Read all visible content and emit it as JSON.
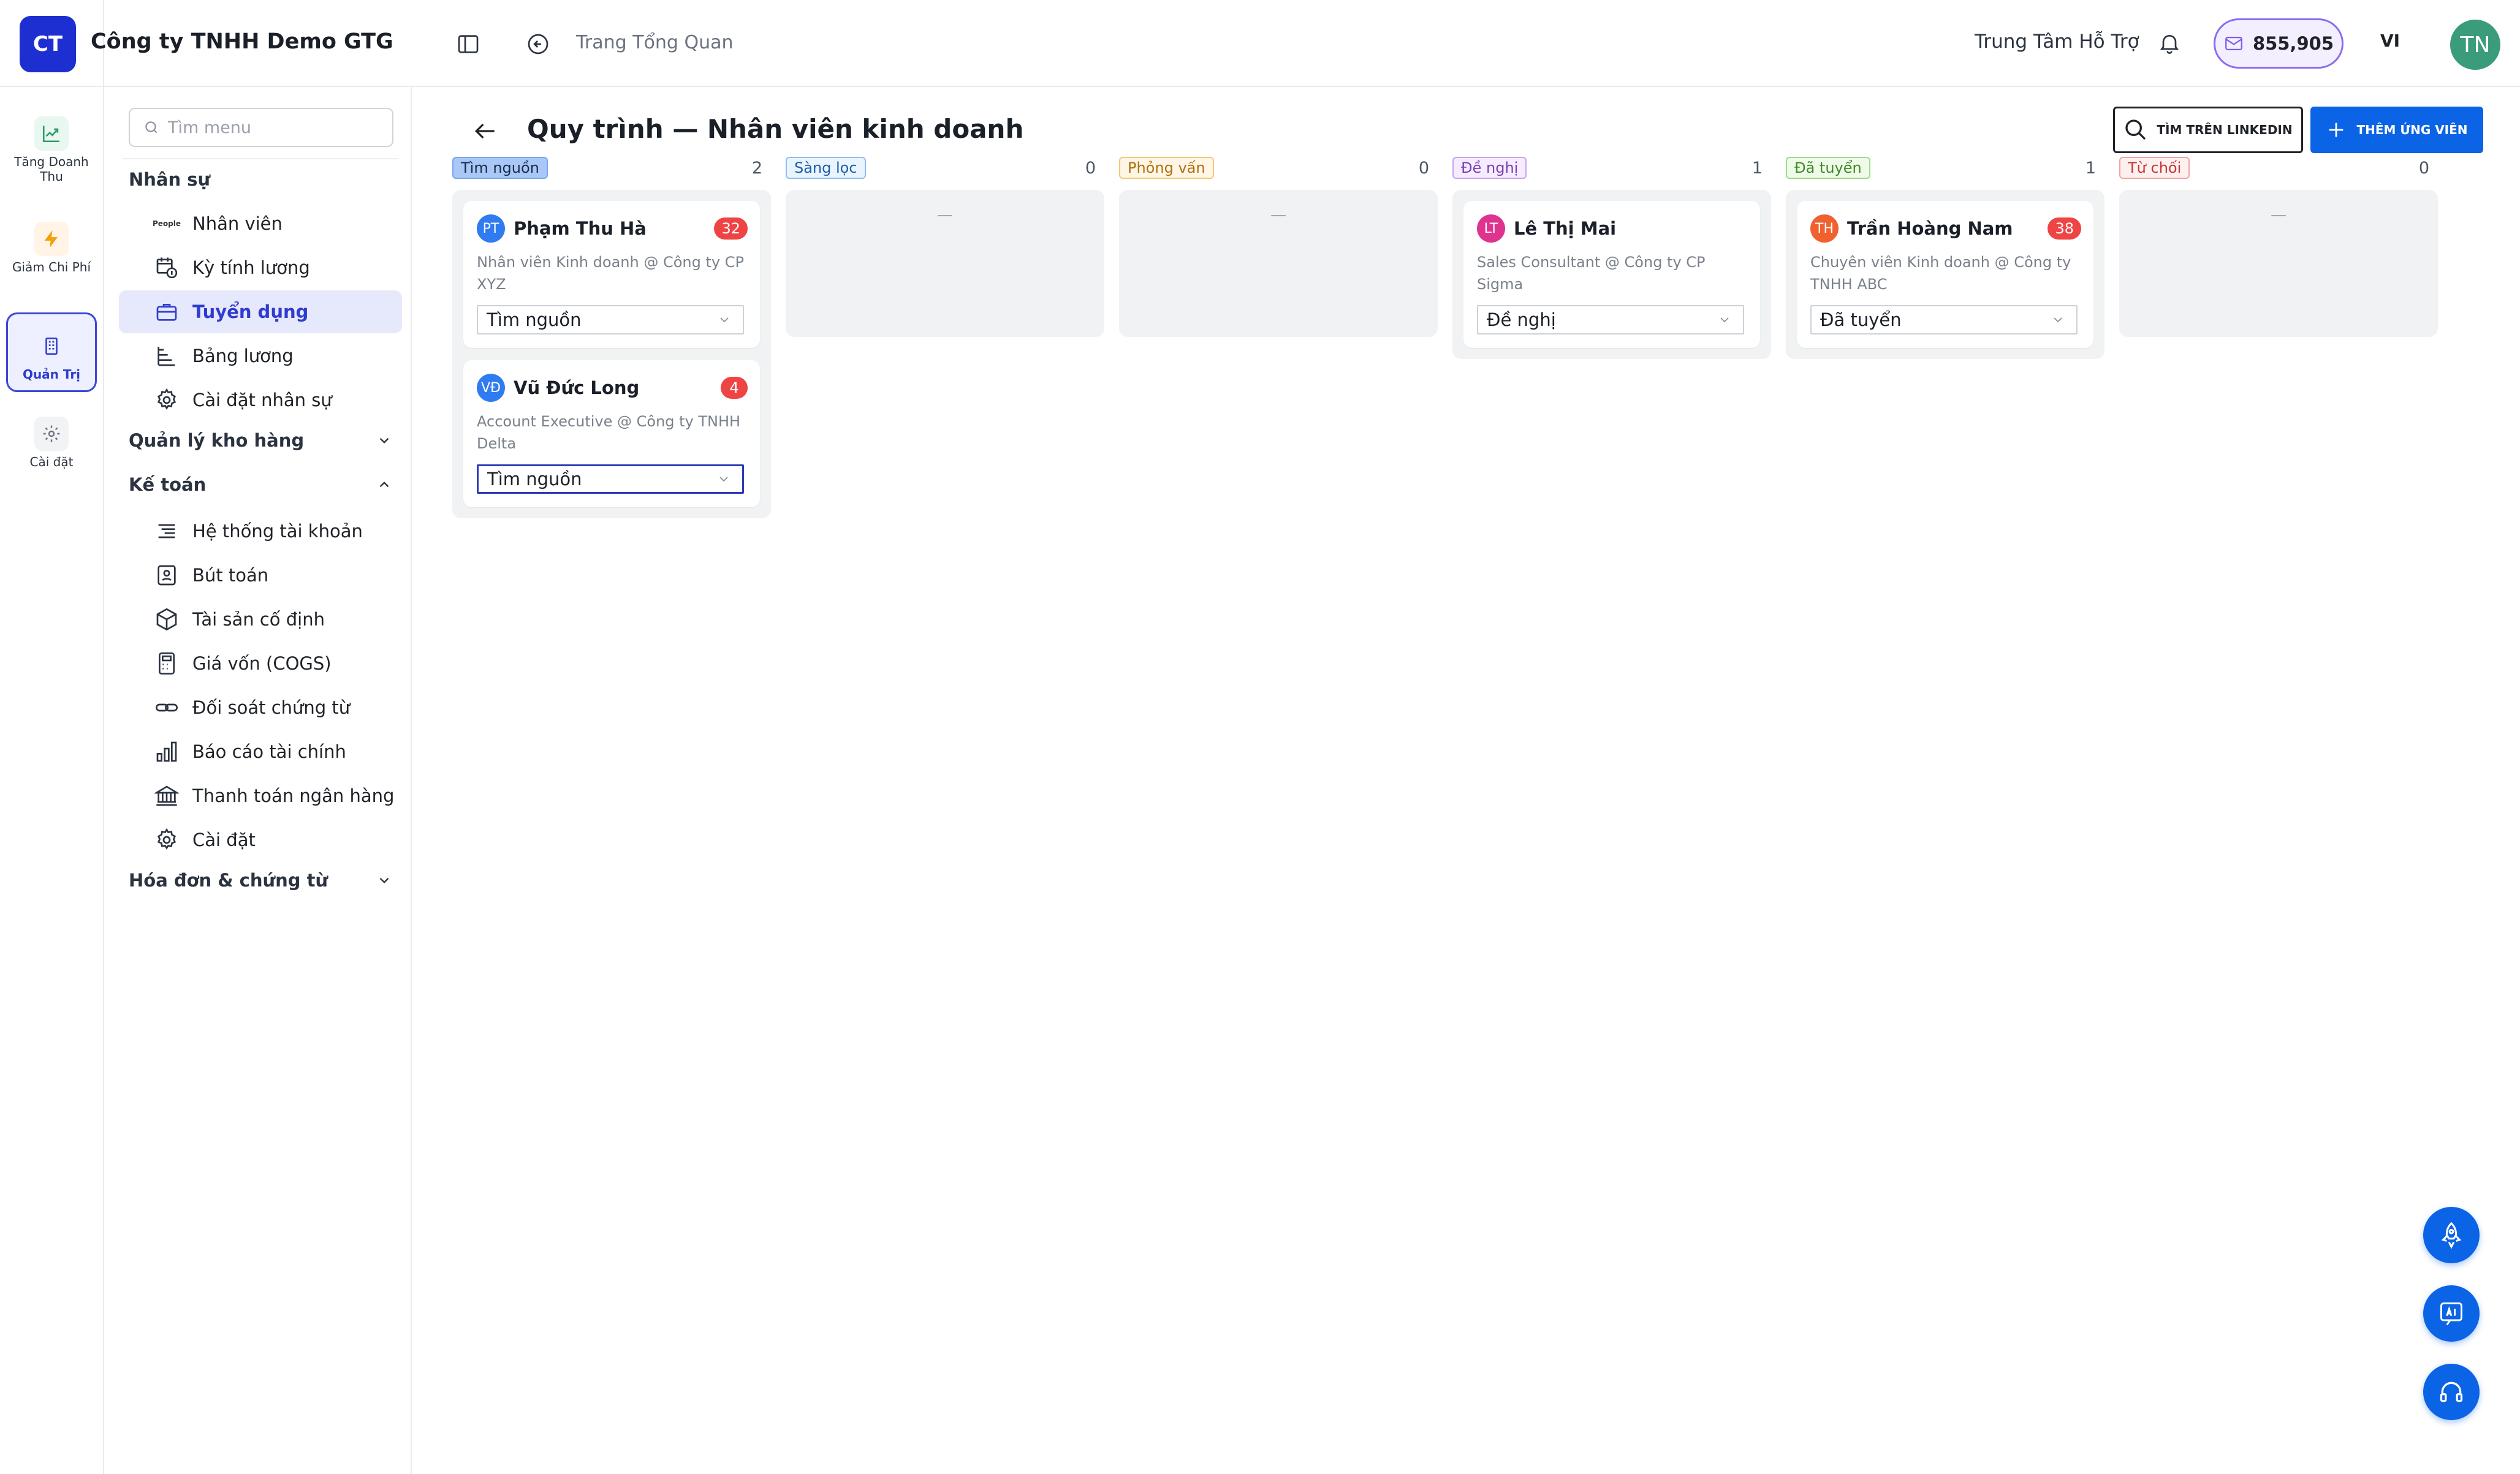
{
  "app": {
    "brand_initials": "CT",
    "company_name": "Công ty TNHH Demo GTG"
  },
  "rail": {
    "items": [
      {
        "label": "Tăng Doanh Thu",
        "icon": "trend-up-icon"
      },
      {
        "label": "Giảm Chi Phí",
        "icon": "lightning-icon"
      },
      {
        "label": "Quản Trị",
        "icon": "building-icon",
        "active": true
      },
      {
        "label": "Cài đặt",
        "icon": "gear-icon"
      }
    ]
  },
  "topbar": {
    "breadcrumb": "Trang Tổng Quan",
    "support_label": "Trung Tâm Hỗ Trợ",
    "credits": "855,905",
    "language": "VI",
    "user_initials": "TN"
  },
  "menu": {
    "search_placeholder": "Tìm menu",
    "sections": {
      "hr": "Nhân sự",
      "warehouse": "Quản lý kho hàng",
      "accounting": "Kế toán",
      "invoices": "Hóa đơn & chứng từ"
    },
    "hr_items": [
      {
        "label": "Nhân viên",
        "icon": "people-icon",
        "icon_text": "People"
      },
      {
        "label": "Kỳ tính lương",
        "icon": "calendar-money-icon"
      },
      {
        "label": "Tuyển dụng",
        "icon": "briefcase-icon",
        "active": true
      },
      {
        "label": "Bảng lương",
        "icon": "list-tree-icon"
      },
      {
        "label": "Cài đặt nhân sự",
        "icon": "gear-icon"
      }
    ],
    "accounting_items": [
      {
        "label": "Hệ thống tài khoản",
        "icon": "lines-icon"
      },
      {
        "label": "Bút toán",
        "icon": "journal-icon"
      },
      {
        "label": "Tài sản cố định",
        "icon": "box-icon"
      },
      {
        "label": "Giá vốn (COGS)",
        "icon": "calculator-icon"
      },
      {
        "label": "Đối soát chứng từ",
        "icon": "link-icon"
      },
      {
        "label": "Báo cáo tài chính",
        "icon": "bar-chart-icon"
      },
      {
        "label": "Thanh toán ngân hàng",
        "icon": "bank-icon"
      },
      {
        "label": "Cài đặt",
        "icon": "gear-icon"
      }
    ]
  },
  "page": {
    "title": "Quy trình — Nhân viên kinh doanh",
    "linkedin_button": "TÌM TRÊN LINKEDIN",
    "add_button": "THÊM ỨNG VIÊN"
  },
  "colors": {
    "primary": "#0b63e5",
    "brand": "#1d2fd0",
    "accent_active": "#2f3ccf",
    "score_badge": "#ef4444"
  },
  "pipeline": {
    "empty_marker": "—",
    "columns": [
      {
        "stage": "Tìm nguồn",
        "count": "2",
        "tag_bg": "#a9c8f7",
        "tag_border": "#7aa7ee",
        "tag_color": "#1a2b4a",
        "cards": [
          {
            "initials": "PT",
            "avatar_color": "#2f7bf0",
            "name": "Phạm Thu Hà",
            "score": "32",
            "role": "Nhân viên Kinh doanh @ Công ty CP XYZ",
            "stage": "Tìm nguồn"
          },
          {
            "initials": "VĐ",
            "avatar_color": "#2f7bf0",
            "name": "Vũ Đức Long",
            "score": "4",
            "role": "Account Executive @ Công ty TNHH Delta",
            "stage": "Tìm nguồn",
            "focused": true
          }
        ]
      },
      {
        "stage": "Sàng lọc",
        "count": "0",
        "tag_bg": "#eaf4ff",
        "tag_border": "#8cc0f2",
        "tag_color": "#1c5fa8",
        "cards": []
      },
      {
        "stage": "Phỏng vấn",
        "count": "0",
        "tag_bg": "#fff6e6",
        "tag_border": "#f3c877",
        "tag_color": "#b0700f",
        "cards": []
      },
      {
        "stage": "Đề nghị",
        "count": "1",
        "tag_bg": "#f6ecff",
        "tag_border": "#c9a3ee",
        "tag_color": "#7a3fb5",
        "cards": [
          {
            "initials": "LT",
            "avatar_color": "#e0338f",
            "name": "Lê Thị Mai",
            "score": "",
            "role": "Sales Consultant @ Công ty CP Sigma",
            "stage": "Đề nghị"
          }
        ]
      },
      {
        "stage": "Đã tuyển",
        "count": "1",
        "tag_bg": "#eefbe8",
        "tag_border": "#9fd98a",
        "tag_color": "#3f8a24",
        "cards": [
          {
            "initials": "TH",
            "avatar_color": "#f0612f",
            "name": "Trần Hoàng Nam",
            "score": "38",
            "role": "Chuyên viên Kinh doanh @ Công ty TNHH ABC",
            "stage": "Đã tuyển"
          }
        ]
      },
      {
        "stage": "Từ chối",
        "count": "0",
        "tag_bg": "#fff0f0",
        "tag_border": "#f2a3a3",
        "tag_color": "#c23838",
        "cards": []
      }
    ]
  }
}
